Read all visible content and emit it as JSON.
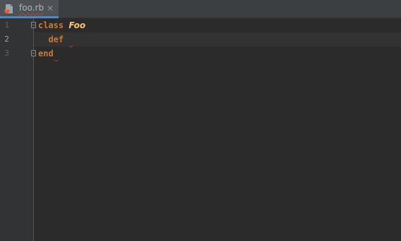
{
  "tab": {
    "filename": "foo.rb",
    "close_glyph": "✕",
    "icon": "ruby-file-icon",
    "has_error": true
  },
  "gutter": {
    "line_numbers": [
      "1",
      "2",
      "3"
    ],
    "current_line": "2"
  },
  "code": {
    "lines": [
      {
        "keyword": "class",
        "name": "Foo"
      },
      {
        "indent": "  ",
        "keyword": "def",
        "error": true
      },
      {
        "keyword": "end",
        "error": true
      }
    ]
  },
  "colors": {
    "background": "#2b2b2b",
    "gutter": "#313335",
    "keyword": "#cc7832",
    "class_name": "#ffc66d",
    "error": "#bc3f3c",
    "tab_accent": "#4a88c7"
  }
}
